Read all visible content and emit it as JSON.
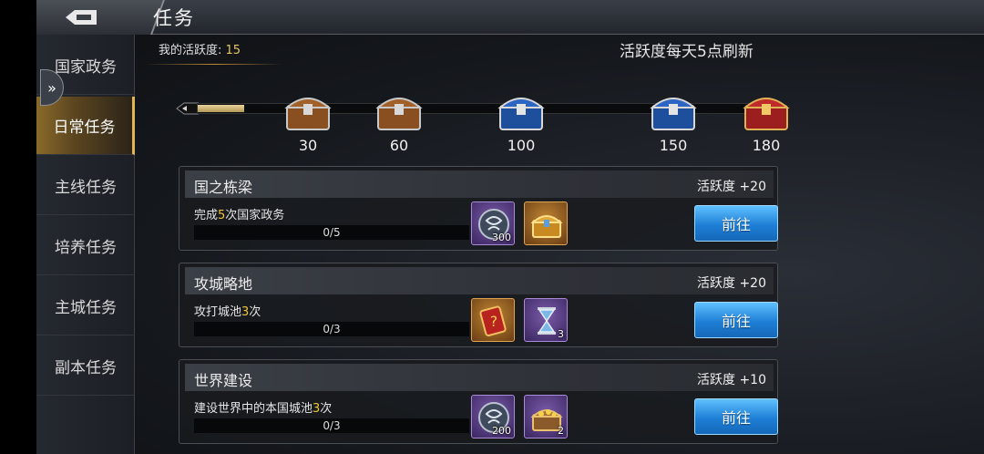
{
  "header": {
    "title": "任务",
    "back_icon": "back-arrow-icon"
  },
  "sidebar": {
    "items": [
      {
        "label": "国家政务",
        "active": false
      },
      {
        "label": "日常任务",
        "active": true
      },
      {
        "label": "主线任务",
        "active": false
      },
      {
        "label": "培养任务",
        "active": false
      },
      {
        "label": "主城任务",
        "active": false
      },
      {
        "label": "副本任务",
        "active": false
      }
    ],
    "expand_icon": "double-chevron-right-icon"
  },
  "activity": {
    "label": "我的活跃度:",
    "value": "15",
    "refresh_note": "活跃度每天5点刷新",
    "progress_fraction": 0.083,
    "chests": [
      {
        "threshold": "30",
        "icon": "wooden-chest-icon"
      },
      {
        "threshold": "60",
        "icon": "wooden-chest-icon"
      },
      {
        "threshold": "100",
        "icon": "blue-chest-icon"
      },
      {
        "threshold": "150",
        "icon": "blue-chest-icon"
      },
      {
        "threshold": "180",
        "icon": "red-chest-icon"
      }
    ]
  },
  "tasks": [
    {
      "name": "国之栋梁",
      "points": "活跃度 +20",
      "desc_prefix": "完成",
      "desc_count": "5",
      "desc_suffix": "次国家政务",
      "progress": "0/5",
      "rewards": [
        {
          "icon": "silver-coin-icon",
          "count": "300"
        },
        {
          "icon": "golden-chest-icon",
          "count": ""
        }
      ],
      "button": "前往"
    },
    {
      "name": "攻城略地",
      "points": "活跃度 +20",
      "desc_prefix": "攻打城池",
      "desc_count": "3",
      "desc_suffix": "次",
      "progress": "0/3",
      "rewards": [
        {
          "icon": "red-scroll-icon",
          "count": ""
        },
        {
          "icon": "hourglass-icon",
          "count": "3"
        }
      ],
      "button": "前往"
    },
    {
      "name": "世界建设",
      "points": "活跃度 +10",
      "desc_prefix": "建设世界中的本国城池",
      "desc_count": "3",
      "desc_suffix": "次",
      "progress": "0/3",
      "rewards": [
        {
          "icon": "silver-coin-icon",
          "count": "200"
        },
        {
          "icon": "treasure-chest-icon",
          "count": "2"
        }
      ],
      "button": "前往"
    }
  ]
}
